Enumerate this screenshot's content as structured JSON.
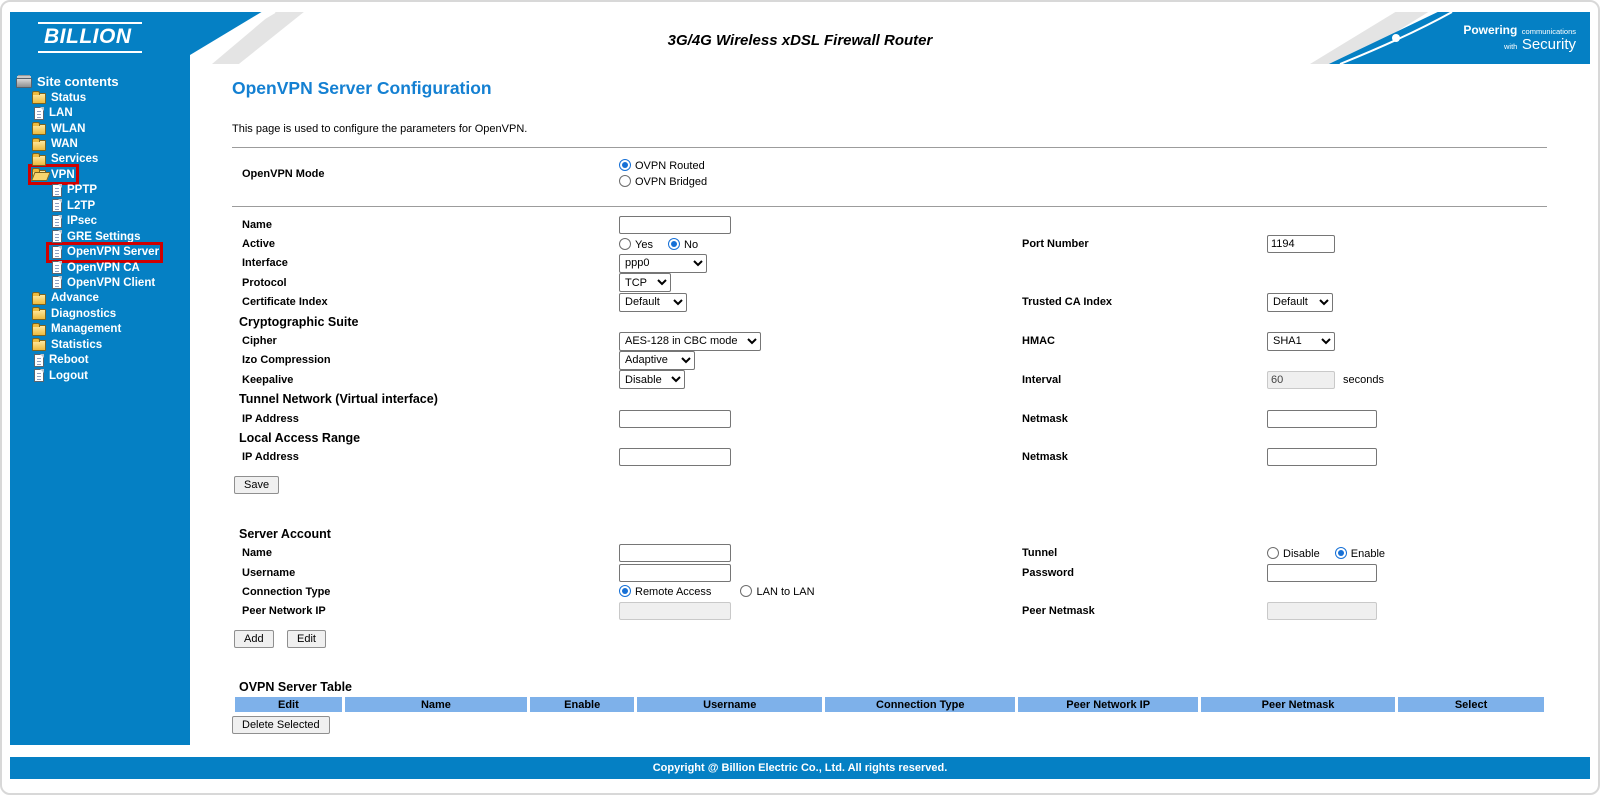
{
  "colors": {
    "brand_blue": "#0580c4",
    "title_blue": "#1480d2",
    "table_header_blue": "#7eb1ea",
    "highlight_red": "#cf0000"
  },
  "header": {
    "logo": "BILLION",
    "product_title": "3G/4G Wireless xDSL Firewall Router",
    "tagline_line1_bold": "Powering",
    "tagline_line1_rest": "communications",
    "tagline_line2_small": "with",
    "tagline_line2_big": "Security"
  },
  "sidebar": {
    "root_label": "Site contents",
    "items": [
      {
        "label": "Status",
        "icon": "folder",
        "level": 1
      },
      {
        "label": "LAN",
        "icon": "doc",
        "level": 1
      },
      {
        "label": "WLAN",
        "icon": "folder",
        "level": 1
      },
      {
        "label": "WAN",
        "icon": "folder",
        "level": 1
      },
      {
        "label": "Services",
        "icon": "folder",
        "level": 1
      },
      {
        "label": "VPN",
        "icon": "folder-open",
        "level": 1,
        "highlight": true
      },
      {
        "label": "PPTP",
        "icon": "doc",
        "level": 2
      },
      {
        "label": "L2TP",
        "icon": "doc",
        "level": 2
      },
      {
        "label": "IPsec",
        "icon": "doc",
        "level": 2
      },
      {
        "label": "GRE Settings",
        "icon": "doc",
        "level": 2
      },
      {
        "label": "OpenVPN Server",
        "icon": "doc",
        "level": 2,
        "highlight": true
      },
      {
        "label": "OpenVPN CA",
        "icon": "doc",
        "level": 2
      },
      {
        "label": "OpenVPN Client",
        "icon": "doc",
        "level": 2
      },
      {
        "label": "Advance",
        "icon": "folder",
        "level": 1
      },
      {
        "label": "Diagnostics",
        "icon": "folder",
        "level": 1
      },
      {
        "label": "Management",
        "icon": "folder",
        "level": 1
      },
      {
        "label": "Statistics",
        "icon": "folder",
        "level": 1
      },
      {
        "label": "Reboot",
        "icon": "doc",
        "level": 1
      },
      {
        "label": "Logout",
        "icon": "doc",
        "level": 1
      }
    ]
  },
  "page": {
    "title": "OpenVPN Server Configuration",
    "description": "This page is used to configure the parameters for OpenVPN."
  },
  "form": {
    "mode": {
      "label": "OpenVPN Mode",
      "routed": "OVPN Routed",
      "bridged": "OVPN Bridged",
      "selected": "OVPN Routed"
    },
    "name": {
      "label": "Name",
      "value": ""
    },
    "active": {
      "label": "Active",
      "yes": "Yes",
      "no": "No",
      "selected": "No"
    },
    "port": {
      "label": "Port Number",
      "value": "1194"
    },
    "interface": {
      "label": "Interface",
      "value": "ppp0"
    },
    "protocol": {
      "label": "Protocol",
      "value": "TCP"
    },
    "certificate": {
      "label": "Certificate Index",
      "value": "Default"
    },
    "trusted_ca": {
      "label": "Trusted CA Index",
      "value": "Default"
    },
    "crypto_heading": "Cryptographic Suite",
    "cipher": {
      "label": "Cipher",
      "value": "AES-128 in CBC mode"
    },
    "hmac": {
      "label": "HMAC",
      "value": "SHA1"
    },
    "izo": {
      "label": "Izo Compression",
      "value": "Adaptive"
    },
    "keepalive": {
      "label": "Keepalive",
      "value": "Disable"
    },
    "interval": {
      "label": "Interval",
      "value": "60",
      "suffix": "seconds"
    },
    "tunnel_net_heading": "Tunnel Network (Virtual interface)",
    "tunnel_ip": {
      "label": "IP Address",
      "value": ""
    },
    "tunnel_netmask": {
      "label": "Netmask",
      "value": ""
    },
    "local_heading": "Local Access Range",
    "local_ip": {
      "label": "IP Address",
      "value": ""
    },
    "local_netmask": {
      "label": "Netmask",
      "value": ""
    },
    "save_label": "Save",
    "account_heading": "Server Account",
    "account_name": {
      "label": "Name",
      "value": ""
    },
    "tunnel": {
      "label": "Tunnel",
      "disable": "Disable",
      "enable": "Enable",
      "selected": "Enable"
    },
    "username": {
      "label": "Username",
      "value": ""
    },
    "password": {
      "label": "Password",
      "value": ""
    },
    "connection": {
      "label": "Connection Type",
      "remote": "Remote Access",
      "lan": "LAN to LAN",
      "selected": "Remote Access"
    },
    "peer_ip": {
      "label": "Peer Network IP",
      "value": ""
    },
    "peer_netmask": {
      "label": "Peer Netmask",
      "value": ""
    },
    "add_label": "Add",
    "edit_label": "Edit"
  },
  "table": {
    "heading": "OVPN Server Table",
    "headers": [
      "Edit",
      "Name",
      "Enable",
      "Username",
      "Connection Type",
      "Peer Network IP",
      "Peer Netmask",
      "Select"
    ],
    "rows": [],
    "delete_label": "Delete Selected"
  },
  "footer": {
    "copyright": "Copyright @ Billion Electric Co., Ltd. All rights reserved."
  }
}
